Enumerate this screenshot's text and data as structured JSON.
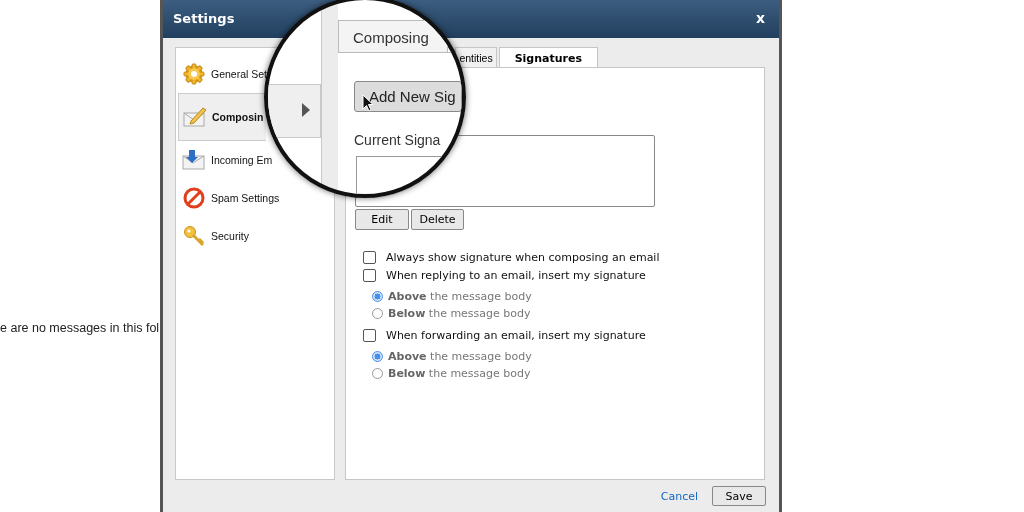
{
  "background": {
    "message": "e are no messages in this fol"
  },
  "window": {
    "title": "Settings",
    "close": "x"
  },
  "sidebar": {
    "items": [
      {
        "label": "General Set",
        "selected": false
      },
      {
        "label": "Composin",
        "selected": true
      },
      {
        "label": "Incoming Em",
        "selected": false
      },
      {
        "label": "Spam Settings",
        "selected": false
      },
      {
        "label": "Security",
        "selected": false
      }
    ]
  },
  "lens": {
    "tab": "Composing",
    "button": "Add New Sig",
    "label": "Current Signa"
  },
  "tabs": [
    {
      "label": "entities",
      "selected": false
    },
    {
      "label": "Signatures",
      "selected": true
    }
  ],
  "signature_buttons": [
    "Edit",
    "Delete"
  ],
  "options": [
    {
      "kind": "checkbox",
      "label": "Always show signature when composing an email",
      "checked": false
    },
    {
      "kind": "checkbox",
      "label": "When replying to an email, insert my signature",
      "checked": false
    },
    {
      "kind": "radio",
      "label": "**Above** the message body",
      "selected": true
    },
    {
      "kind": "radio",
      "label": "**Below** the message body",
      "selected": false
    },
    {
      "kind": "checkbox",
      "label": "When forwarding an email, insert my signature",
      "checked": false
    },
    {
      "kind": "radio",
      "label": "**Above** the message body",
      "selected": true
    },
    {
      "kind": "radio",
      "label": "**Below** the message body",
      "selected": false
    }
  ],
  "footer": {
    "cancel": "Cancel",
    "save": "Save"
  }
}
